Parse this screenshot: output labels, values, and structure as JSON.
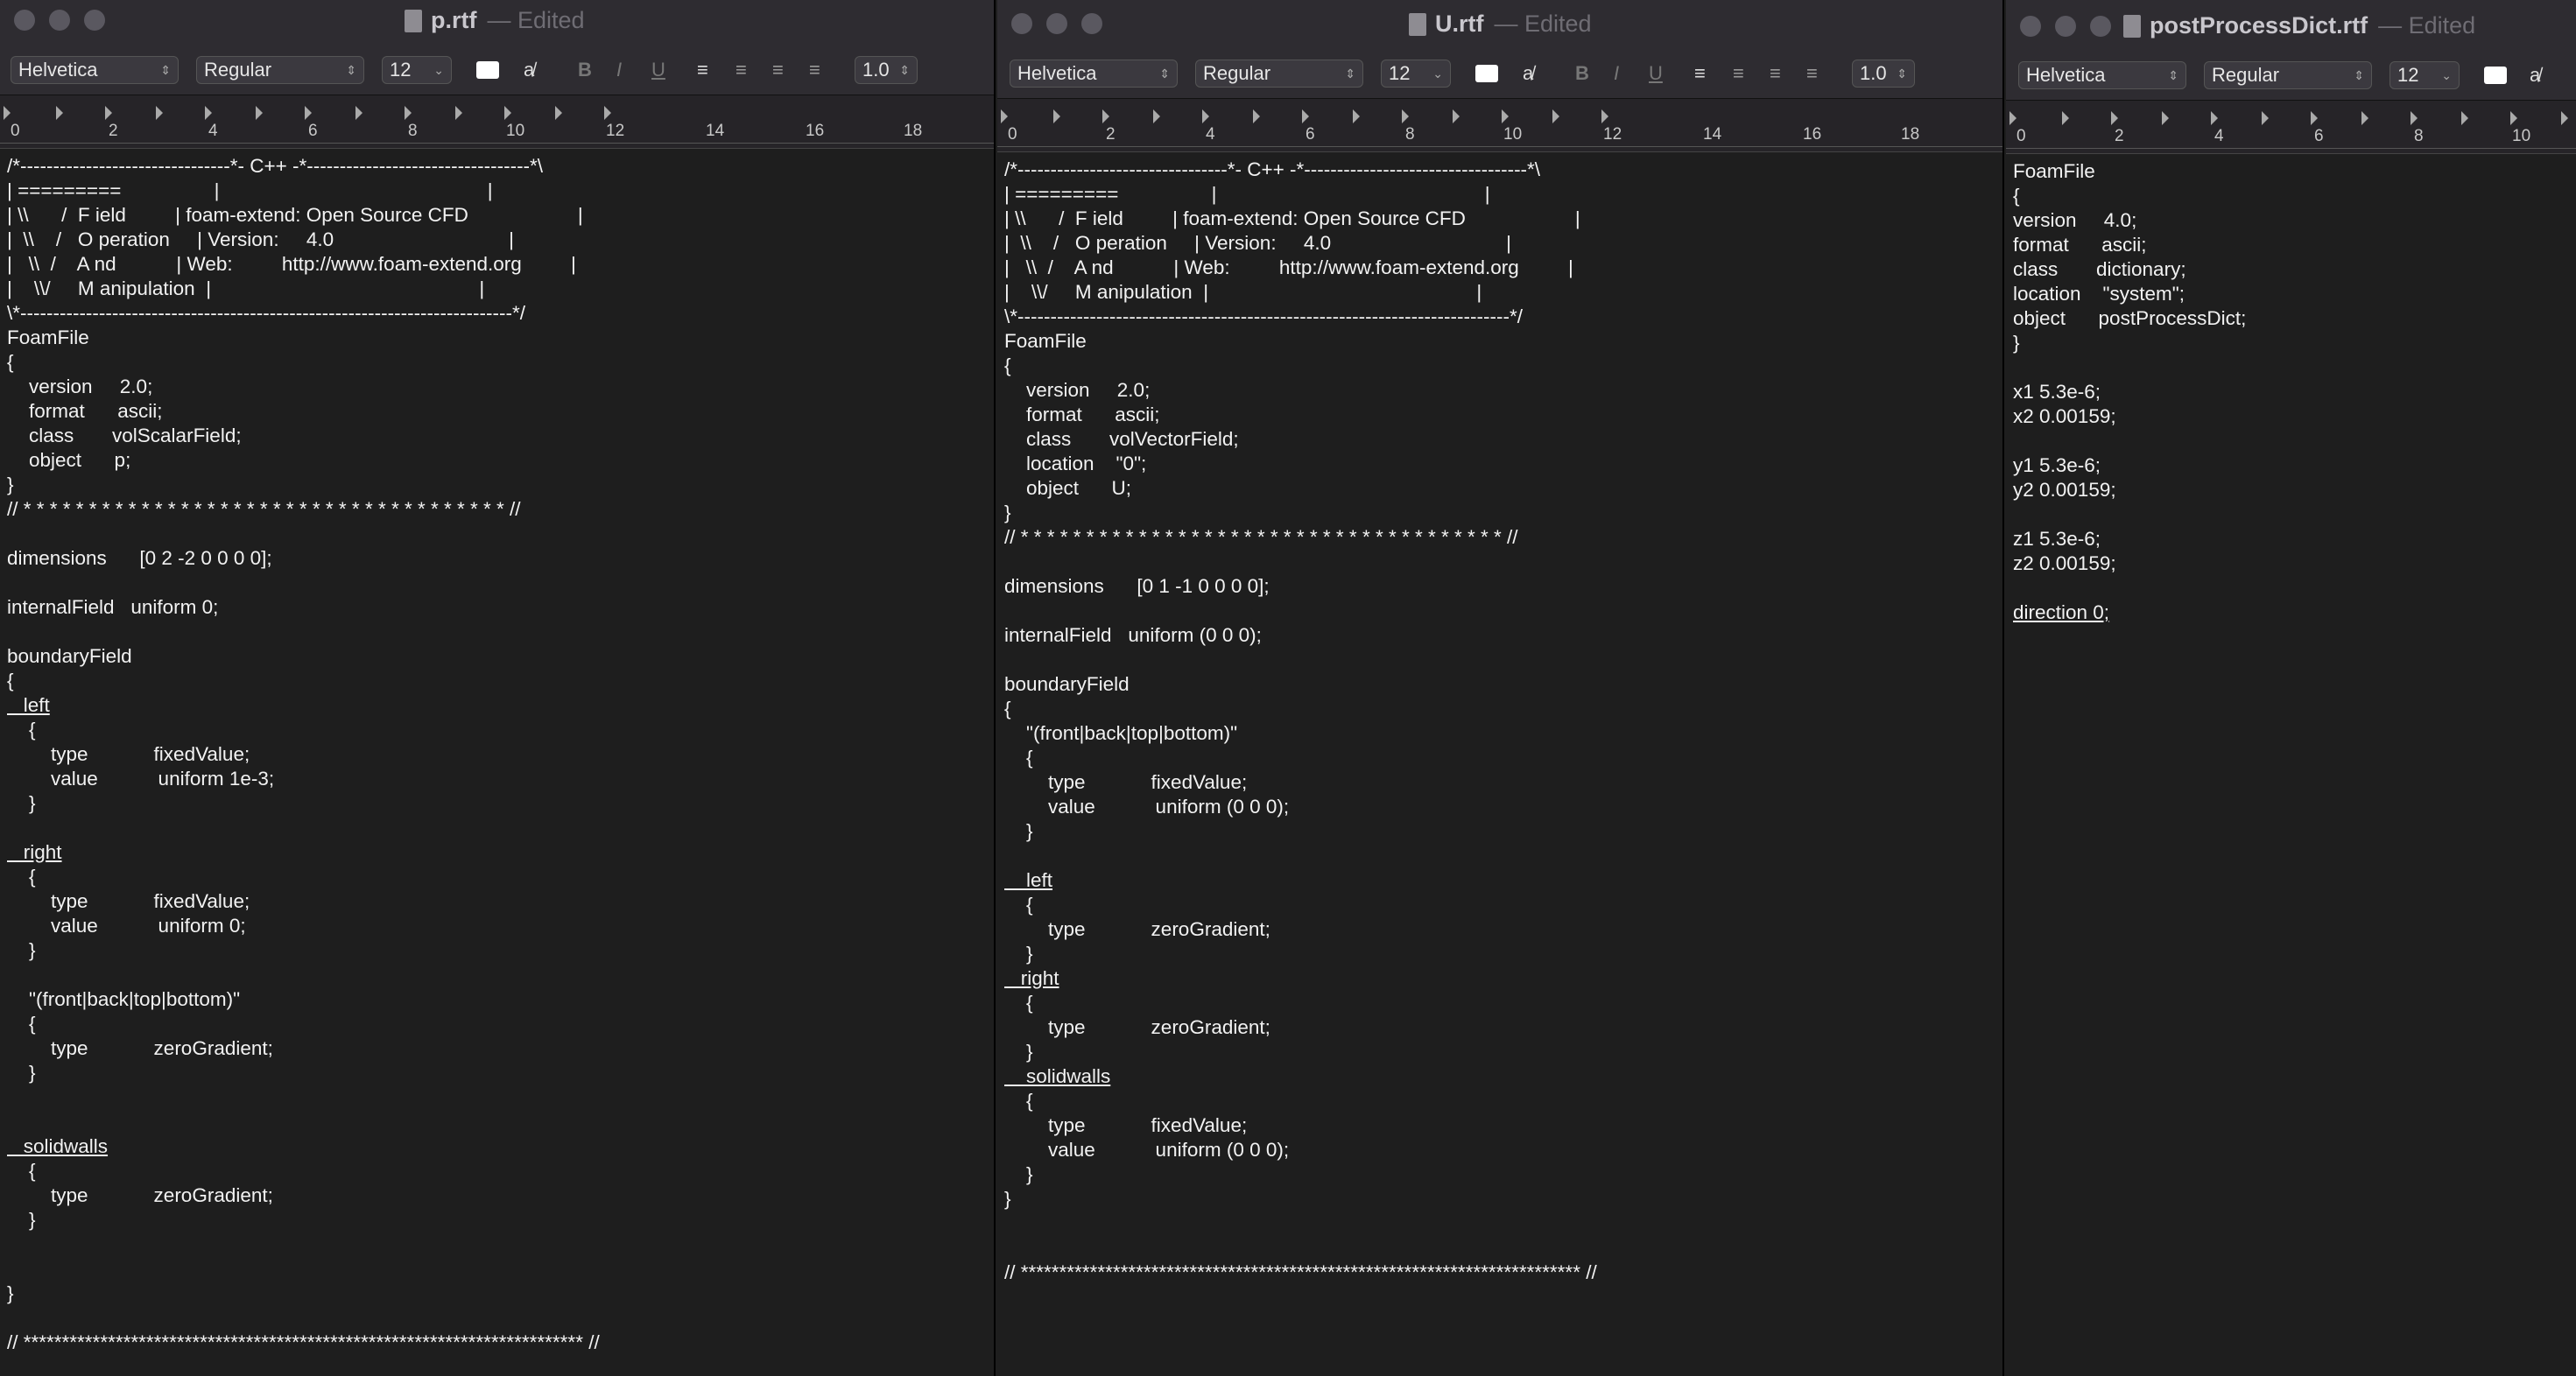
{
  "toolbar": {
    "font": "Helvetica",
    "style": "Regular",
    "size": "12",
    "spacing": "1.0",
    "bold": "B",
    "italic": "I",
    "underline": "U"
  },
  "ruler_numbers": [
    "0",
    "2",
    "4",
    "6",
    "8",
    "10",
    "12",
    "14",
    "16",
    "18"
  ],
  "windows": [
    {
      "id": "p",
      "name": "p.rtf",
      "edited": "— Edited",
      "lines": [
        "/*--------------------------------*- C++ -*----------------------------------*\\",
        "| =========                 |                                                 |",
        "| \\\\      /  F ield         | foam-extend: Open Source CFD                    |",
        "|  \\\\    /   O peration     | Version:     4.0                                |",
        "|   \\\\  /    A nd           | Web:         http://www.foam-extend.org         |",
        "|    \\\\/     M anipulation  |                                                 |",
        "\\*---------------------------------------------------------------------------*/",
        "FoamFile",
        "{",
        "    version     2.0;",
        "    format      ascii;",
        "    class       volScalarField;",
        "    object      p;",
        "}",
        "// * * * * * * * * * * * * * * * * * * * * * * * * * * * * * * * * * * * * * //",
        "",
        "dimensions      [0 2 -2 0 0 0 0];",
        "",
        "internalField   uniform 0;",
        "",
        "boundaryField",
        "{",
        "   left",
        "    {",
        "        type            fixedValue;",
        "        value           uniform 1e-3;",
        "    }",
        "",
        "   right",
        "    {",
        "        type            fixedValue;",
        "        value           uniform 0;",
        "    }",
        "",
        "    \"(front|back|top|bottom)\"",
        "    {",
        "        type            zeroGradient;",
        "    }",
        "",
        "",
        "   solidwalls",
        "    {",
        "        type            zeroGradient;",
        "    }",
        "",
        "",
        "}",
        "",
        "// ************************************************************************* //"
      ]
    },
    {
      "id": "U",
      "name": "U.rtf",
      "edited": "— Edited",
      "lines": [
        "/*--------------------------------*- C++ -*----------------------------------*\\",
        "| =========                 |                                                 |",
        "| \\\\      /  F ield         | foam-extend: Open Source CFD                    |",
        "|  \\\\    /   O peration     | Version:     4.0                                |",
        "|   \\\\  /    A nd           | Web:         http://www.foam-extend.org         |",
        "|    \\\\/     M anipulation  |                                                 |",
        "\\*---------------------------------------------------------------------------*/",
        "FoamFile",
        "{",
        "    version     2.0;",
        "    format      ascii;",
        "    class       volVectorField;",
        "    location    \"0\";",
        "    object      U;",
        "}",
        "// * * * * * * * * * * * * * * * * * * * * * * * * * * * * * * * * * * * * * //",
        "",
        "dimensions      [0 1 -1 0 0 0 0];",
        "",
        "internalField   uniform (0 0 0);",
        "",
        "boundaryField",
        "{",
        "    \"(front|back|top|bottom)\"",
        "    {",
        "        type            fixedValue;",
        "        value           uniform (0 0 0);",
        "    }",
        "",
        "    left",
        "    {",
        "        type            zeroGradient;",
        "    }",
        "   right",
        "    {",
        "        type            zeroGradient;",
        "    }",
        "    solidwalls",
        "    {",
        "        type            fixedValue;",
        "        value           uniform (0 0 0);",
        "    }",
        "}",
        "",
        "",
        "// ************************************************************************* //"
      ]
    },
    {
      "id": "postProcessDict",
      "name": "postProcessDict.rtf",
      "edited": "— Edited",
      "lines": [
        "FoamFile",
        "{",
        "version     4.0;",
        "format      ascii;",
        "class       dictionary;",
        "location    \"system\";",
        "object      postProcessDict;",
        "}",
        "",
        "x1 5.3e-6;",
        "x2 0.00159;",
        "",
        "y1 5.3e-6;",
        "y2 0.00159;",
        "",
        "z1 5.3e-6;",
        "z2 0.00159;",
        "",
        "direction 0;"
      ]
    }
  ]
}
